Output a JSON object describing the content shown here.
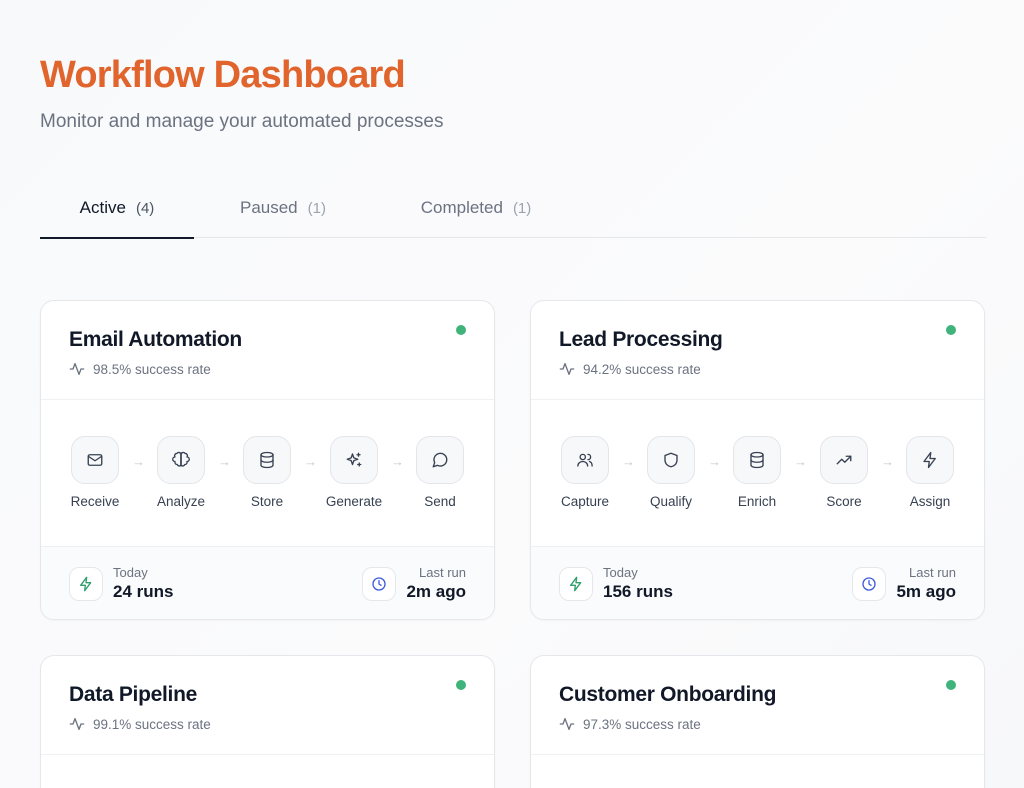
{
  "header": {
    "title": "Workflow Dashboard",
    "subtitle": "Monitor and manage your automated processes"
  },
  "tabs": [
    {
      "label": "Active",
      "count": "(4)",
      "active": true
    },
    {
      "label": "Paused",
      "count": "(1)",
      "active": false
    },
    {
      "label": "Completed",
      "count": "(1)",
      "active": false
    }
  ],
  "colors": {
    "accent": "#e0642c",
    "status_active": "#3fb37a",
    "clock": "#3b5bdb",
    "bolt": "#2f9e6b"
  },
  "workflows": [
    {
      "title": "Email Automation",
      "rate": "98.5% success rate",
      "steps": [
        {
          "label": "Receive",
          "icon": "mail-icon"
        },
        {
          "label": "Analyze",
          "icon": "brain-icon"
        },
        {
          "label": "Store",
          "icon": "database-icon"
        },
        {
          "label": "Generate",
          "icon": "sparkles-icon"
        },
        {
          "label": "Send",
          "icon": "message-circle-icon"
        }
      ],
      "today_label": "Today",
      "today_value": "24 runs",
      "last_label": "Last run",
      "last_value": "2m ago"
    },
    {
      "title": "Lead Processing",
      "rate": "94.2% success rate",
      "steps": [
        {
          "label": "Capture",
          "icon": "users-icon"
        },
        {
          "label": "Qualify",
          "icon": "shield-icon"
        },
        {
          "label": "Enrich",
          "icon": "database-icon"
        },
        {
          "label": "Score",
          "icon": "trending-up-icon"
        },
        {
          "label": "Assign",
          "icon": "bolt-icon"
        }
      ],
      "today_label": "Today",
      "today_value": "156 runs",
      "last_label": "Last run",
      "last_value": "5m ago"
    },
    {
      "title": "Data Pipeline",
      "rate": "99.1% success rate"
    },
    {
      "title": "Customer Onboarding",
      "rate": "97.3% success rate"
    }
  ]
}
